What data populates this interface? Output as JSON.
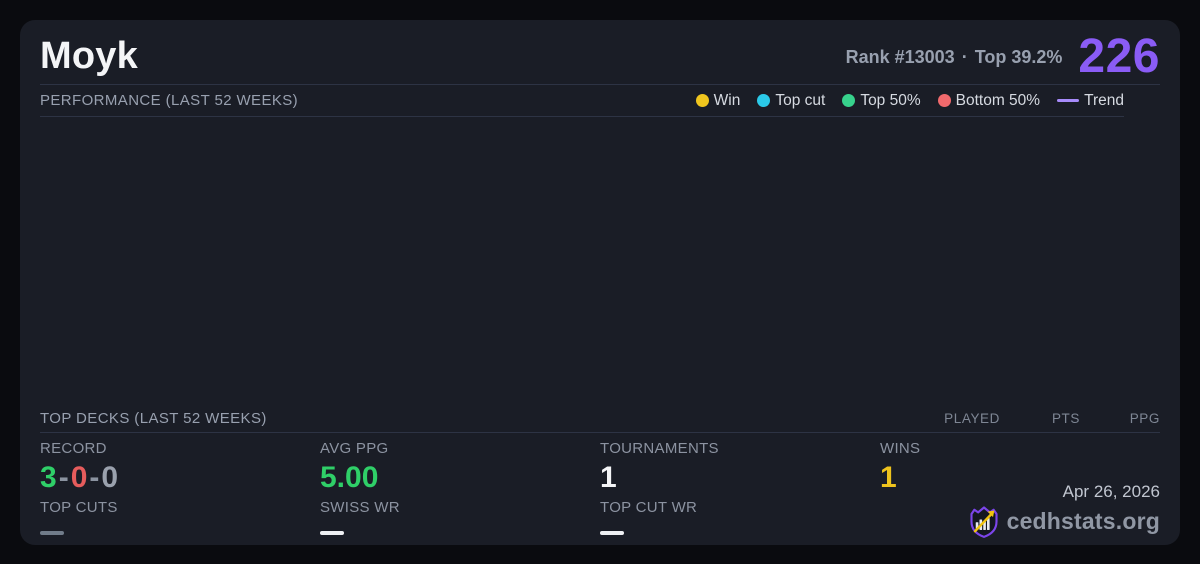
{
  "player": {
    "name": "Moyk",
    "rank_text": "Rank #13003",
    "separator": "·",
    "top_percent": "Top 39.2%",
    "score": "226"
  },
  "performance": {
    "title": "PERFORMANCE (LAST 52 WEEKS)",
    "legend": [
      {
        "label": "Win",
        "color": "#f0c61e"
      },
      {
        "label": "Top cut",
        "color": "#2bc9e8"
      },
      {
        "label": "Top 50%",
        "color": "#37d28c"
      },
      {
        "label": "Bottom 50%",
        "color": "#f0696c"
      }
    ],
    "trend": {
      "label": "Trend",
      "color": "#a78bfa"
    }
  },
  "chart_data": {
    "type": "scatter",
    "title": "PERFORMANCE (LAST 52 WEEKS)",
    "series": [
      {
        "name": "Win",
        "points": []
      },
      {
        "name": "Top cut",
        "points": []
      },
      {
        "name": "Top 50%",
        "points": []
      },
      {
        "name": "Bottom 50%",
        "points": []
      },
      {
        "name": "Trend",
        "points": []
      }
    ],
    "note": "chart area rendered empty in screenshot"
  },
  "top_decks": {
    "title": "TOP DECKS (LAST 52 WEEKS)",
    "columns": [
      "PLAYED",
      "PTS",
      "PPG"
    ],
    "rows": []
  },
  "stats": {
    "record": {
      "label": "RECORD",
      "wins": "3",
      "losses": "0",
      "draws": "0",
      "sep": "-"
    },
    "avg_ppg": {
      "label": "AVG PPG",
      "value": "5.00"
    },
    "tournaments": {
      "label": "TOURNAMENTS",
      "value": "1"
    },
    "wins": {
      "label": "WINS",
      "value": "1"
    },
    "top_cuts": {
      "label": "TOP CUTS",
      "value": "—"
    },
    "swiss_wr": {
      "label": "SWISS WR",
      "value": "—"
    },
    "top_cut_wr": {
      "label": "TOP CUT WR",
      "value": "—"
    }
  },
  "footer": {
    "date": "Apr 26, 2026",
    "site": "cedhstats.org"
  },
  "colors": {
    "accent_purple": "#8a5cf5",
    "value_green": "#2fcf68",
    "value_red": "#e65c5c",
    "value_yellow": "#eec31d",
    "value_gray": "#9aa1ad",
    "card_bg": "#1a1d26",
    "page_bg": "#0a0b0f",
    "divider": "#2d3344"
  }
}
